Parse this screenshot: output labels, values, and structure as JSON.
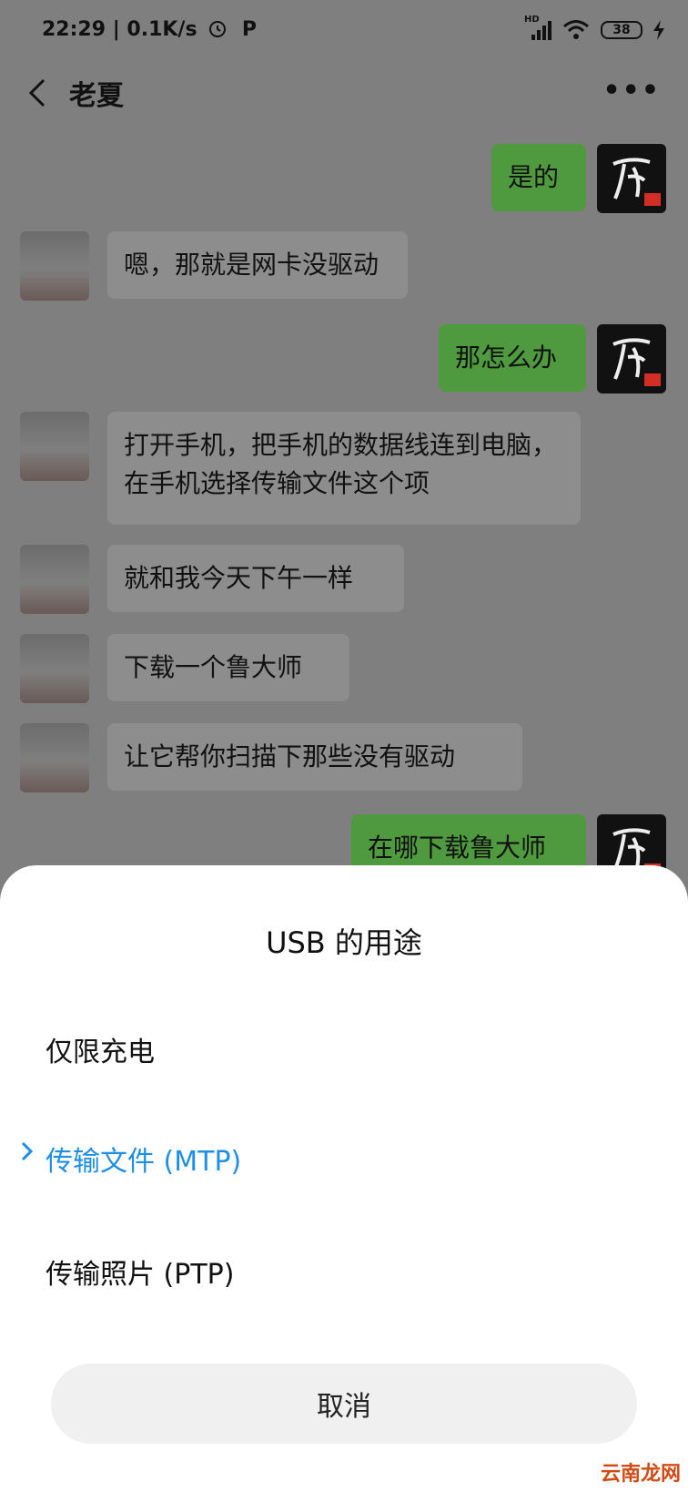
{
  "status_bar": {
    "time": "22:29",
    "net_speed": "| 0.1K/s",
    "hd": "HD",
    "battery": "38"
  },
  "header": {
    "title": "老夏",
    "more": "•••"
  },
  "messages": [
    {
      "side": "right",
      "text": "是的"
    },
    {
      "side": "left",
      "text": "嗯，那就是网卡没驱动"
    },
    {
      "side": "right",
      "text": "那怎么办"
    },
    {
      "side": "left",
      "text": "打开手机，把手机的数据线连到电脑，在手机选择传输文件这个项"
    },
    {
      "side": "left",
      "text": "就和我今天下午一样"
    },
    {
      "side": "left",
      "text": "下载一个鲁大师"
    },
    {
      "side": "left",
      "text": "让它帮你扫描下那些没有驱动"
    },
    {
      "side": "right",
      "text": "在哪下载鲁大师"
    }
  ],
  "usb_sheet": {
    "title": "USB 的用途",
    "options": [
      {
        "label": "仅限充电",
        "selected": false
      },
      {
        "label": "传输文件 (MTP)",
        "selected": true
      },
      {
        "label": "传输照片 (PTP)",
        "selected": false
      }
    ],
    "cancel_label": "取消"
  },
  "watermark": "云南龙网",
  "colors": {
    "accent": "#1e8ee6",
    "bubble_right": "#4f9a3e"
  }
}
